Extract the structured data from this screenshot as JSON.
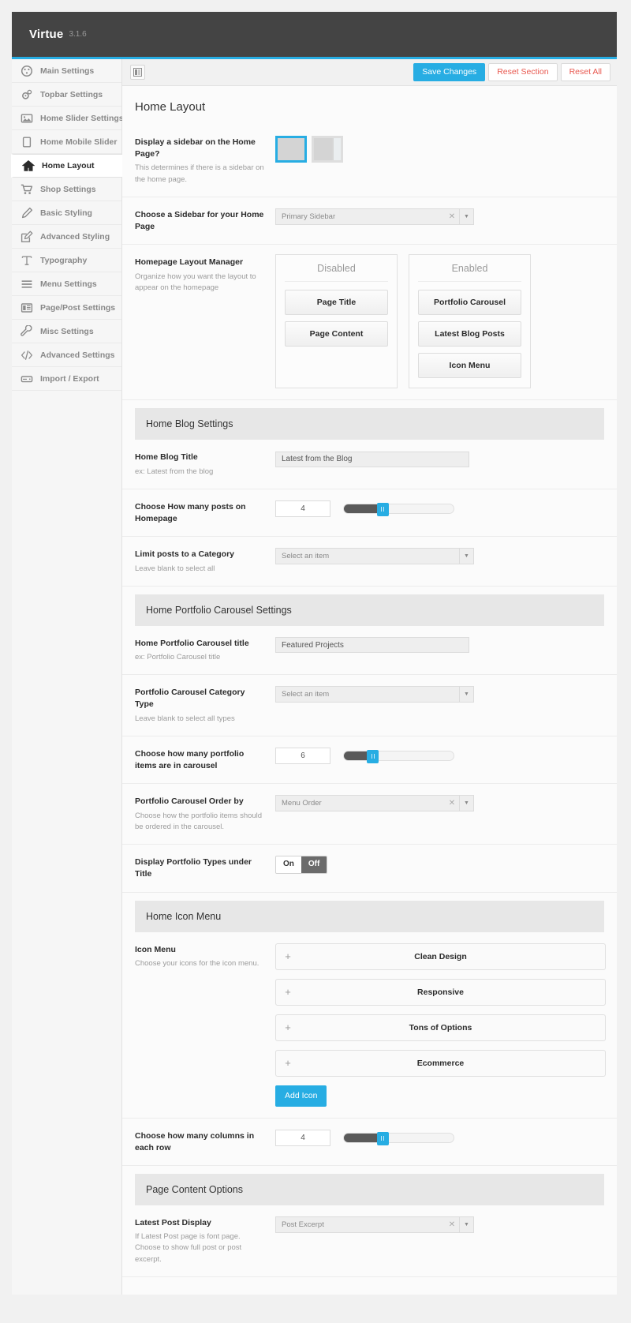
{
  "header": {
    "brand": "Virtue",
    "version": "3.1.6"
  },
  "toolbar": {
    "tab_icon": "panel-icon",
    "save_label": "Save Changes",
    "reset_section_label": "Reset Section",
    "reset_all_label": "Reset All",
    "accent_color": "#27ADE3"
  },
  "sidebar": {
    "items": [
      {
        "label": "Main Settings",
        "icon": "dashboard-icon",
        "active": false
      },
      {
        "label": "Topbar Settings",
        "icon": "gears-icon",
        "active": false
      },
      {
        "label": "Home Slider Settings",
        "icon": "image-icon",
        "active": false
      },
      {
        "label": "Home Mobile Slider",
        "icon": "tablet-icon",
        "active": false
      },
      {
        "label": "Home Layout",
        "icon": "home-icon",
        "active": true
      },
      {
        "label": "Shop Settings",
        "icon": "cart-icon",
        "active": false
      },
      {
        "label": "Basic Styling",
        "icon": "pencil-icon",
        "active": false
      },
      {
        "label": "Advanced Styling",
        "icon": "edit-square-icon",
        "active": false
      },
      {
        "label": "Typography",
        "icon": "text-t-icon",
        "active": false
      },
      {
        "label": "Menu Settings",
        "icon": "menu-lines-icon",
        "active": false
      },
      {
        "label": "Page/Post Settings",
        "icon": "page-layout-icon",
        "active": false
      },
      {
        "label": "Misc Settings",
        "icon": "wrench-icon",
        "active": false
      },
      {
        "label": "Advanced Settings",
        "icon": "code-icon",
        "active": false
      },
      {
        "label": "Import / Export",
        "icon": "drive-icon",
        "active": false
      }
    ]
  },
  "page": {
    "title": "Home Layout",
    "sidebar_display": {
      "label": "Display a sidebar on the Home Page?",
      "desc": "This determines if there is a sidebar on the home page.",
      "options": [
        "full-width",
        "with-sidebar"
      ],
      "selected_index": 0
    },
    "sidebar_choice": {
      "label": "Choose a Sidebar for your Home Page",
      "value": "Primary Sidebar"
    },
    "layout_manager": {
      "label": "Homepage Layout Manager",
      "desc": "Organize how you want the layout to appear on the homepage",
      "disabled_title": "Disabled",
      "enabled_title": "Enabled",
      "disabled_items": [
        "Page Title",
        "Page Content"
      ],
      "enabled_items": [
        "Portfolio Carousel",
        "Latest Blog Posts",
        "Icon Menu"
      ]
    },
    "blog_section": {
      "title": "Home Blog Settings",
      "blog_title": {
        "label": "Home Blog Title",
        "desc": "ex: Latest from the blog",
        "value": "Latest from the Blog"
      },
      "posts_count": {
        "label": "Choose How many posts on Homepage",
        "value": "4",
        "percent": 33
      },
      "category": {
        "label": "Limit posts to a Category",
        "desc": "Leave blank to select all",
        "placeholder": "Select an item"
      }
    },
    "portfolio_section": {
      "title": "Home Portfolio Carousel Settings",
      "carousel_title": {
        "label": "Home Portfolio Carousel title",
        "desc": "ex: Portfolio Carousel title",
        "value": "Featured Projects"
      },
      "category_type": {
        "label": "Portfolio Carousel Category Type",
        "desc": "Leave blank to select all types",
        "placeholder": "Select an item"
      },
      "items_count": {
        "label": "Choose how many portfolio items are in carousel",
        "value": "6",
        "percent": 24
      },
      "order_by": {
        "label": "Portfolio Carousel Order by",
        "desc": "Choose how the portfolio items should be ordered in the carousel.",
        "value": "Menu Order"
      },
      "display_types": {
        "label": "Display Portfolio Types under Title",
        "on_label": "On",
        "off_label": "Off",
        "selected": "Off"
      }
    },
    "icon_menu_section": {
      "title": "Home Icon Menu",
      "icon_menu": {
        "label": "Icon Menu",
        "desc": "Choose your icons for the icon menu.",
        "items": [
          "Clean Design",
          "Responsive",
          "Tons of Options",
          "Ecommerce"
        ],
        "add_label": "Add Icon"
      },
      "columns": {
        "label": "Choose how many columns in each row",
        "value": "4",
        "percent": 33
      }
    },
    "page_content_section": {
      "title": "Page Content Options",
      "latest_post_display": {
        "label": "Latest Post Display",
        "desc": "If Latest Post page is font page. Choose to show full post or post excerpt.",
        "value": "Post Excerpt"
      }
    }
  }
}
